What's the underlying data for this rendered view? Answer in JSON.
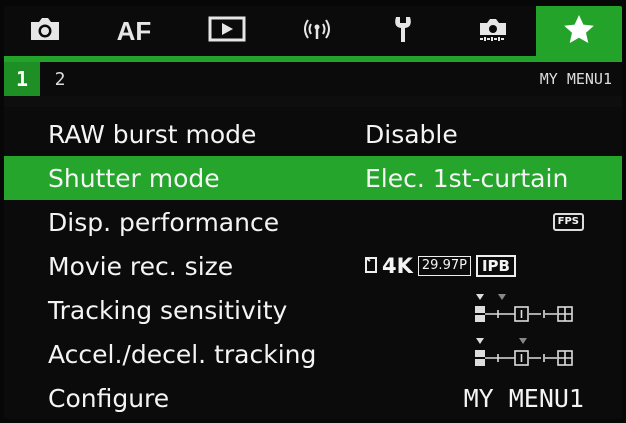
{
  "tabs": [
    {
      "icon": "camera-icon"
    },
    {
      "label": "AF"
    },
    {
      "icon": "playback-icon"
    },
    {
      "icon": "wireless-icon"
    },
    {
      "icon": "wrench-icon"
    },
    {
      "icon": "custom-function-icon"
    },
    {
      "icon": "star-icon",
      "active": true
    }
  ],
  "sub_tabs": [
    "1",
    "2"
  ],
  "menu_title": "MY MENU1",
  "items": [
    {
      "label": "RAW burst mode",
      "value": "Disable"
    },
    {
      "label": "Shutter mode",
      "value": "Elec. 1st-curtain",
      "selected": true
    },
    {
      "label": "Disp. performance",
      "value_icon": "fps-icon",
      "value_icon_text": "FPS"
    },
    {
      "label": "Movie rec. size",
      "value_parts": [
        "4K",
        "29.97P",
        "IPB"
      ]
    },
    {
      "label": "Tracking sensitivity",
      "value_icon": "sensitivity-scale-icon",
      "level": 0
    },
    {
      "label": "Accel./decel. tracking",
      "value_icon": "accel-scale-icon",
      "level": 0
    },
    {
      "label": "Configure",
      "value": "MY MENU1"
    }
  ],
  "colors": {
    "accent": "#23a32a",
    "background": "#0b0b0b",
    "text": "#f4f4f4"
  }
}
